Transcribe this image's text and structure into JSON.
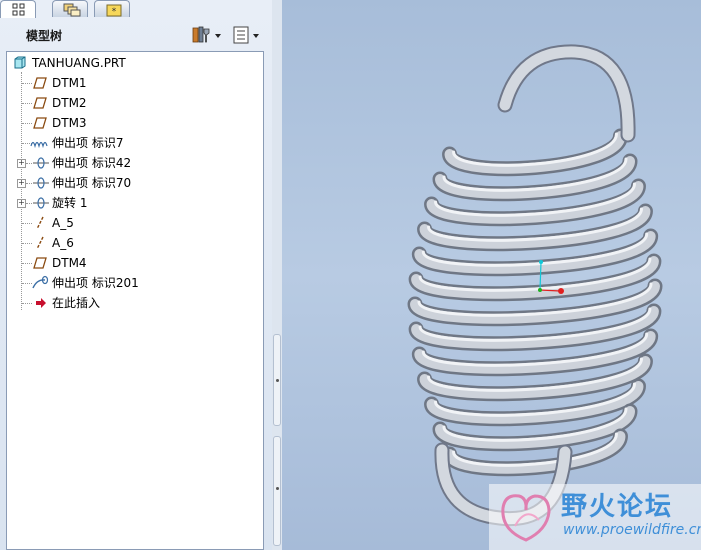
{
  "panel": {
    "title": "模型树",
    "tabs": [
      {
        "name": "model-tree-tab",
        "icon": "tree-icon",
        "active": true
      },
      {
        "name": "layers-tab",
        "icon": "layers-icon",
        "active": false
      },
      {
        "name": "favorites-tab",
        "icon": "star-folder-icon",
        "active": false
      }
    ],
    "tools": [
      {
        "name": "tree-tools-button",
        "icon": "tools-icon"
      },
      {
        "name": "tree-settings-button",
        "icon": "list-settings-icon"
      }
    ]
  },
  "tree": {
    "root": "TANHUANG.PRT",
    "items": [
      {
        "label": "DTM1",
        "icon": "datum-plane-icon",
        "expandable": false
      },
      {
        "label": "DTM2",
        "icon": "datum-plane-icon",
        "expandable": false
      },
      {
        "label": "DTM3",
        "icon": "datum-plane-icon",
        "expandable": false
      },
      {
        "label": "伸出项 标识7",
        "icon": "protrusion-icon",
        "expandable": false
      },
      {
        "label": "伸出项 标识42",
        "icon": "protrusion-revolve-icon",
        "expandable": true
      },
      {
        "label": "伸出项 标识70",
        "icon": "protrusion-revolve-icon",
        "expandable": true
      },
      {
        "label": "旋转 1",
        "icon": "revolve-icon",
        "expandable": true
      },
      {
        "label": "A_5",
        "icon": "datum-axis-icon",
        "expandable": false
      },
      {
        "label": "A_6",
        "icon": "datum-axis-icon",
        "expandable": false
      },
      {
        "label": "DTM4",
        "icon": "datum-plane-icon",
        "expandable": false
      },
      {
        "label": "伸出项 标识201",
        "icon": "sweep-icon",
        "expandable": false
      },
      {
        "label": "在此插入",
        "icon": "insert-here-arrow-icon",
        "expandable": false
      }
    ]
  },
  "colors": {
    "viewport_bg": "#b3c7e1",
    "spring": "#c9ced6",
    "insert_arrow": "#c8102e"
  },
  "watermark": {
    "title": "野火论坛",
    "url": "www.proewildfire.cn"
  }
}
